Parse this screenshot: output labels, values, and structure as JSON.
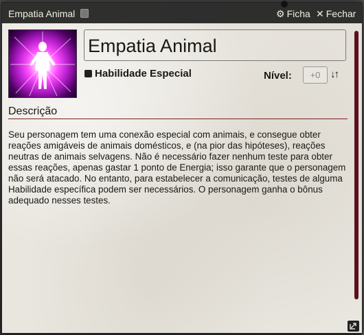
{
  "window": {
    "title": "Empatia Animal",
    "header_buttons": {
      "ficha_label": "Ficha",
      "ficha_icon": "gear-icon",
      "fechar_label": "Fechar",
      "fechar_icon": "close-icon"
    }
  },
  "item": {
    "name": "Empatia Animal",
    "type_label": "Habilidade Especial",
    "level_label": "Nível:",
    "level_value": "+0",
    "sort_icon": "sort-arrows-icon"
  },
  "description": {
    "title": "Descrição",
    "text": "Seu personagem tem uma conexão especial com animais, e consegue obter reações amigáveis de animais domésticos, e (na pior das hipóteses), reações neutras de animais selvagens. Não é necessário fazer nenhum teste para obter essas reações, apenas gastar 1 ponto de Energia; isso garante que o personagem não será atacado. No entanto, para estabelecer a comunicação, testes de alguma Habilidade específica podem ser necessários. O personagem ganha o bônus adequado nesses testes."
  },
  "colors": {
    "titlebar": "#1e1e1e",
    "accent_rule": "#7a1e1e",
    "scrollbar": "#5a1020",
    "portrait_glow": "#ff4fff"
  }
}
